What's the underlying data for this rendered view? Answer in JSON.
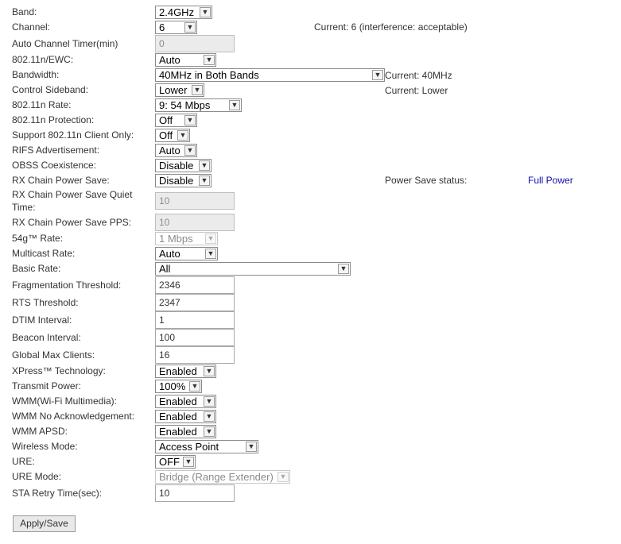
{
  "form": {
    "band": {
      "label": "Band:",
      "value": "2.4GHz"
    },
    "channel": {
      "label": "Channel:",
      "value": "6",
      "status": "Current: 6 (interference: acceptable)"
    },
    "auto_channel_timer": {
      "label": "Auto Channel Timer(min)",
      "value": "0"
    },
    "ewc": {
      "label": "802.11n/EWC:",
      "value": "Auto"
    },
    "bandwidth": {
      "label": "Bandwidth:",
      "value": "40MHz in Both Bands",
      "status": "Current: 40MHz"
    },
    "control_sideband": {
      "label": "Control Sideband:",
      "value": "Lower",
      "status": "Current: Lower"
    },
    "n_rate": {
      "label": "802.11n Rate:",
      "value": "9: 54 Mbps"
    },
    "n_protection": {
      "label": "802.11n Protection:",
      "value": "Off"
    },
    "n_client_only": {
      "label": "Support 802.11n Client Only:",
      "value": "Off"
    },
    "rifs": {
      "label": "RIFS Advertisement:",
      "value": "Auto"
    },
    "obss": {
      "label": "OBSS Coexistence:",
      "value": "Disable"
    },
    "rx_power_save": {
      "label": "RX Chain Power Save:",
      "value": "Disable",
      "status_label": "Power Save status:",
      "status_value": "Full Power"
    },
    "rx_quiet_time": {
      "label_line1": "RX Chain Power Save Quiet",
      "label_line2": "Time:",
      "value": "10"
    },
    "rx_pps": {
      "label": "RX Chain Power Save PPS:",
      "value": "10"
    },
    "g_rate": {
      "label": "54g™ Rate:",
      "value": "1 Mbps"
    },
    "multicast_rate": {
      "label": "Multicast Rate:",
      "value": "Auto"
    },
    "basic_rate": {
      "label": "Basic Rate:",
      "value": "All"
    },
    "frag_threshold": {
      "label": "Fragmentation Threshold:",
      "value": "2346"
    },
    "rts_threshold": {
      "label": "RTS Threshold:",
      "value": "2347"
    },
    "dtim": {
      "label": "DTIM Interval:",
      "value": "1"
    },
    "beacon": {
      "label": "Beacon Interval:",
      "value": "100"
    },
    "max_clients": {
      "label": "Global Max Clients:",
      "value": "16"
    },
    "xpress": {
      "label": "XPress™ Technology:",
      "value": "Enabled"
    },
    "tx_power": {
      "label": "Transmit Power:",
      "value": "100%"
    },
    "wmm": {
      "label": "WMM(Wi-Fi Multimedia):",
      "value": "Enabled"
    },
    "wmm_noack": {
      "label": "WMM No Acknowledgement:",
      "value": "Enabled"
    },
    "wmm_apsd": {
      "label": "WMM APSD:",
      "value": "Enabled"
    },
    "wireless_mode": {
      "label": "Wireless Mode:",
      "value": "Access Point"
    },
    "ure": {
      "label": "URE:",
      "value": "OFF"
    },
    "ure_mode": {
      "label": "URE Mode:",
      "value": "Bridge (Range Extender)"
    },
    "sta_retry": {
      "label": "STA Retry Time(sec):",
      "value": "10"
    }
  },
  "apply_label": "Apply/Save",
  "colors": {
    "status_value": "#1111aa"
  }
}
